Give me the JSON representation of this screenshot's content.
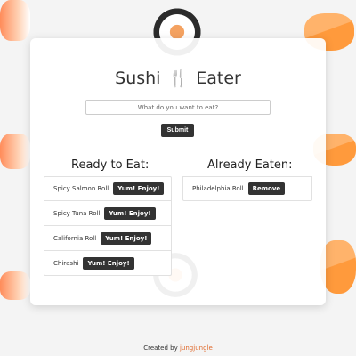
{
  "app": {
    "title_left": "Sushi",
    "title_icon": "fork-knife-icon",
    "title_right": "Eater"
  },
  "search": {
    "placeholder": "What do you want to eat?",
    "value": ""
  },
  "submit_label": "Submit",
  "ready": {
    "heading": "Ready to Eat:",
    "items": [
      {
        "label": "Spicy Salmon Roll",
        "button": "Yum! Enjoy!"
      },
      {
        "label": "Spicy Tuna Roll",
        "button": "Yum! Enjoy!"
      },
      {
        "label": "California Roll",
        "button": "Yum! Enjoy!"
      },
      {
        "label": "Chirashi",
        "button": "Yum! Enjoy!"
      }
    ]
  },
  "eaten": {
    "heading": "Already Eaten:",
    "items": [
      {
        "label": "Philadelphia Roll",
        "button": "Remove"
      }
    ]
  },
  "footer": {
    "prefix": "Created by",
    "author": "jungjungle"
  },
  "colors": {
    "accent": "#e0692b",
    "button": "#333333"
  }
}
